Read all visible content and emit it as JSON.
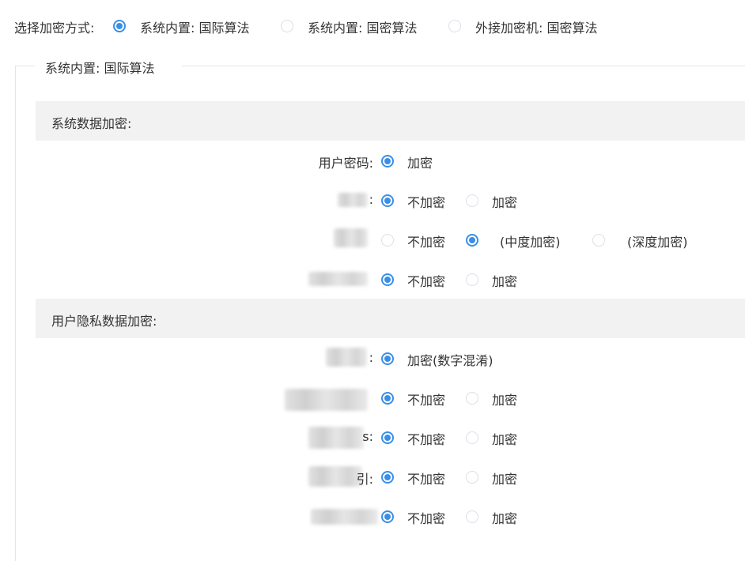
{
  "encryption_mode": {
    "label": "选择加密方式:",
    "options": [
      {
        "label": "系统内置: 国际算法",
        "checked": true
      },
      {
        "label": "系统内置: 国密算法",
        "checked": false
      },
      {
        "label": "外接加密机: 国密算法",
        "checked": false
      }
    ]
  },
  "fieldset": {
    "legend": "系统内置: 国际算法"
  },
  "system_data": {
    "title": "系统数据加密:",
    "rows": [
      {
        "label": "用户密码:",
        "options": [
          {
            "label": "加密",
            "checked": true
          }
        ]
      },
      {
        "label": ":",
        "options": [
          {
            "label": "不加密",
            "checked": true
          },
          {
            "label": "加密",
            "checked": false
          }
        ]
      },
      {
        "label": "",
        "options": [
          {
            "label": "不加密",
            "checked": false
          },
          {
            "label": "(中度加密)",
            "checked": true
          },
          {
            "label": "(深度加密)",
            "checked": false
          }
        ]
      },
      {
        "label": "",
        "options": [
          {
            "label": "不加密",
            "checked": true
          },
          {
            "label": "加密",
            "checked": false
          }
        ]
      }
    ]
  },
  "privacy_data": {
    "title": "用户隐私数据加密:",
    "rows": [
      {
        "label": ":",
        "options": [
          {
            "label": "加密(数字混淆)",
            "checked": true
          }
        ]
      },
      {
        "label": "",
        "options": [
          {
            "label": "不加密",
            "checked": true
          },
          {
            "label": "加密",
            "checked": false
          }
        ]
      },
      {
        "label": "s:",
        "options": [
          {
            "label": "不加密",
            "checked": true
          },
          {
            "label": "加密",
            "checked": false
          }
        ]
      },
      {
        "label": "引:",
        "options": [
          {
            "label": "不加密",
            "checked": true
          },
          {
            "label": "加密",
            "checked": false
          }
        ]
      },
      {
        "label": "",
        "options": [
          {
            "label": "不加密",
            "checked": true
          },
          {
            "label": "加密",
            "checked": false
          }
        ]
      }
    ]
  },
  "colors": {
    "accent": "#3a8ee6",
    "section_bg": "#f2f2f2",
    "border": "#e5e5e5",
    "text": "#333333"
  }
}
